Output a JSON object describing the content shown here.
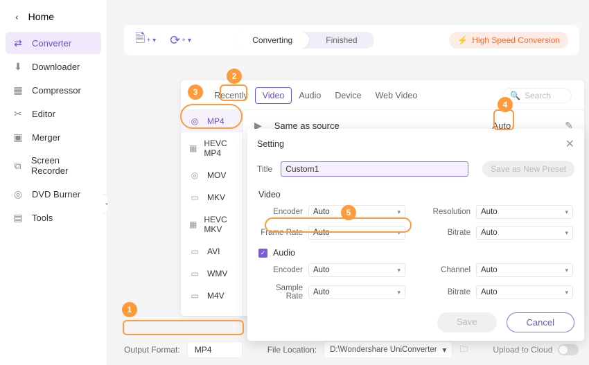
{
  "titlebar": {
    "user": "●"
  },
  "sidebar": {
    "home": "Home",
    "items": [
      {
        "label": "Converter"
      },
      {
        "label": "Downloader"
      },
      {
        "label": "Compressor"
      },
      {
        "label": "Editor"
      },
      {
        "label": "Merger"
      },
      {
        "label": "Screen Recorder"
      },
      {
        "label": "DVD Burner"
      },
      {
        "label": "Tools"
      }
    ]
  },
  "topbar": {
    "tab_converting": "Converting",
    "tab_finished": "Finished",
    "high_speed": "High Speed Conversion"
  },
  "format_panel": {
    "tabs": {
      "recently": "Recently",
      "video": "Video",
      "audio": "Audio",
      "device": "Device",
      "web_video": "Web Video"
    },
    "search_placeholder": "Search",
    "formats": [
      {
        "label": "MP4"
      },
      {
        "label": "HEVC MP4"
      },
      {
        "label": "MOV"
      },
      {
        "label": "MKV"
      },
      {
        "label": "HEVC MKV"
      },
      {
        "label": "AVI"
      },
      {
        "label": "WMV"
      },
      {
        "label": "M4V"
      }
    ],
    "preset": {
      "name": "Same as source",
      "quality": "Auto"
    }
  },
  "callouts": [
    "1",
    "2",
    "3",
    "4",
    "5"
  ],
  "bottom": {
    "output_format_label": "Output Format:",
    "output_format_value": "MP4",
    "file_location_label": "File Location:",
    "file_location_value": "D:\\Wondershare UniConverter",
    "upload_label": "Upload to Cloud"
  },
  "modal": {
    "heading": "Setting",
    "title_label": "Title",
    "title_value": "Custom1",
    "save_preset": "Save as New Preset",
    "video_hdr": "Video",
    "audio_hdr": "Audio",
    "labels": {
      "encoder": "Encoder",
      "resolution": "Resolution",
      "frame_rate": "Frame Rate",
      "bitrate": "Bitrate",
      "channel": "Channel",
      "sample_rate": "Sample Rate"
    },
    "values": {
      "v_encoder": "Auto",
      "v_resolution": "Auto",
      "v_frame_rate": "Auto",
      "v_bitrate": "Auto",
      "a_encoder": "Auto",
      "a_channel": "Auto",
      "a_sample_rate": "Auto",
      "a_bitrate": "Auto"
    },
    "save": "Save",
    "cancel": "Cancel"
  }
}
